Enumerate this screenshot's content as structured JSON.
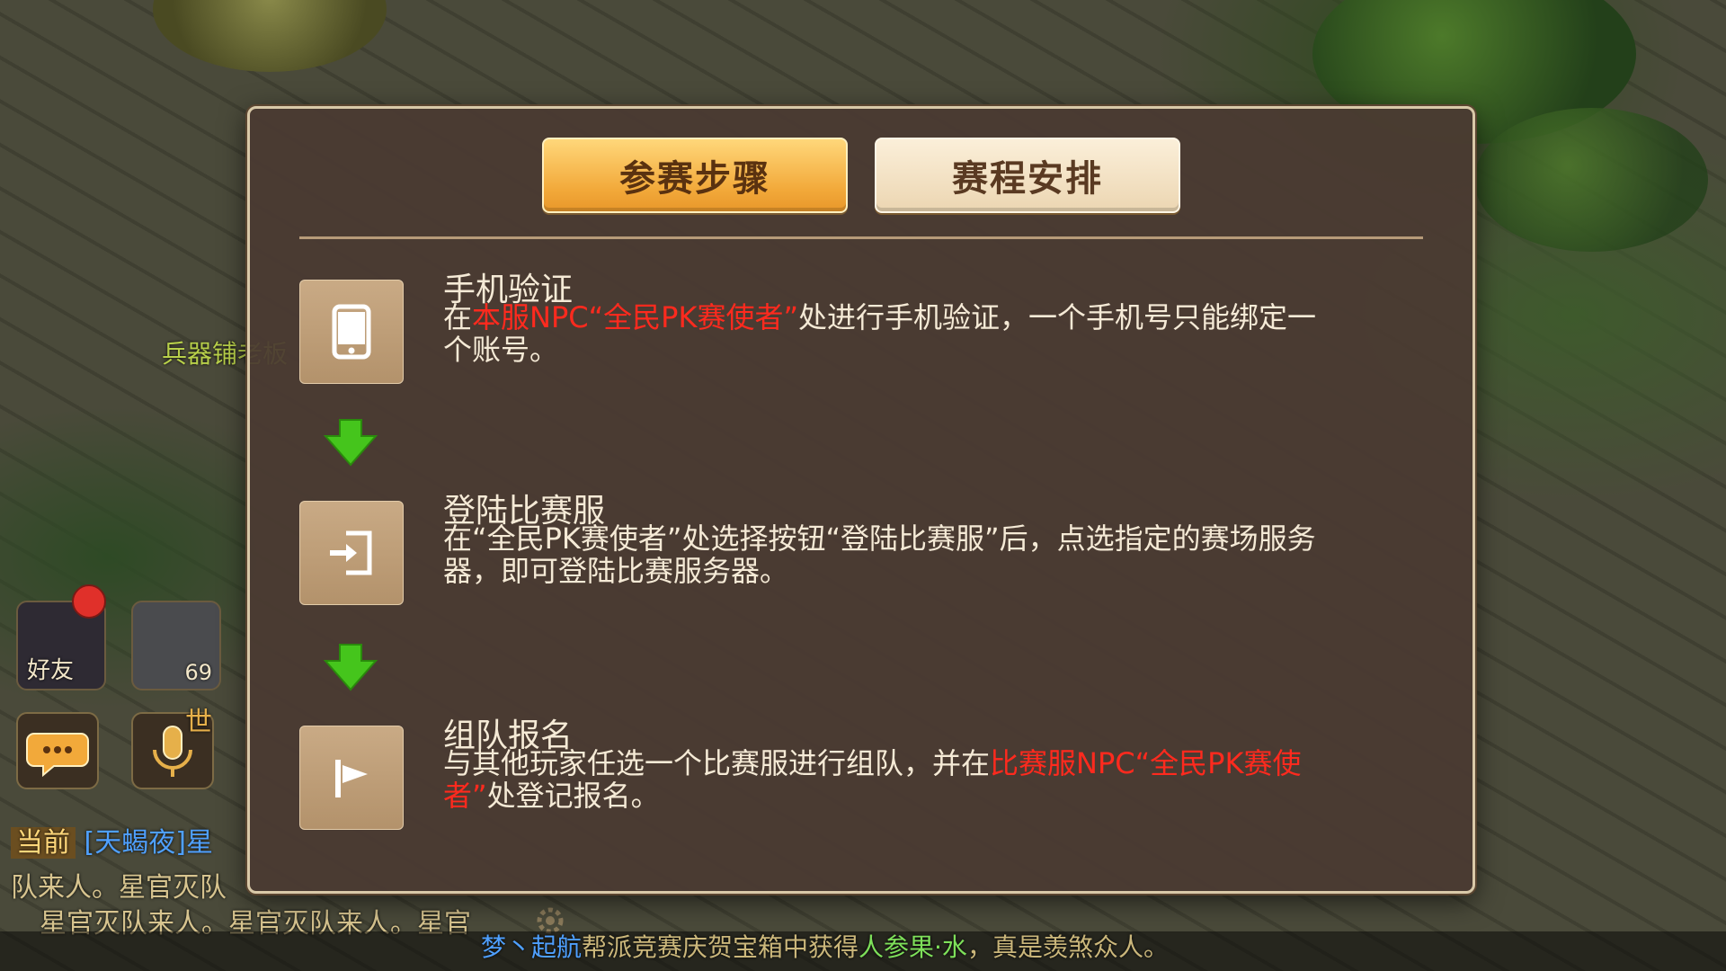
{
  "tabs": {
    "active_label": "参赛步骤",
    "inactive_label": "赛程安排"
  },
  "steps": [
    {
      "title": "手机验证",
      "desc_pre": "在",
      "desc_red": "本服NPC“全民PK赛使者”",
      "desc_post": "处进行手机验证，一个手机号只能绑定一个账号。",
      "icon": "phone-icon"
    },
    {
      "title": "登陆比赛服",
      "desc": "在“全民PK赛使者”处选择按钮“登陆比赛服”后，点选指定的赛场服务器，即可登陆比赛服务器。",
      "icon": "login-icon"
    },
    {
      "title": "组队报名",
      "desc_pre": "与其他玩家任选一个比赛服进行组队，并在",
      "desc_red": "比赛服NPC“全民PK赛使者”",
      "desc_post": "处登记报名。",
      "icon": "flag-icon"
    }
  ],
  "hud": {
    "friend_label": "好友",
    "player_level": "69",
    "world_label": "世",
    "npc_label": "兵器铺老板"
  },
  "chat": {
    "channel": "当前",
    "sender": "[天蝎夜]星",
    "line1": "队来人。星官灭队",
    "line2": "星官灭队来人。星官灭队来人。星官"
  },
  "bottom": {
    "name": "梦丶起航",
    "mid": "帮派竞赛庆贺宝箱中获得",
    "item": "人参果·水",
    "end": "，真是羡煞众人。"
  },
  "colors": {
    "highlight_red": "#ff2a1e",
    "tab_active": "#f2a93a",
    "arrow_green": "#45c51c"
  }
}
